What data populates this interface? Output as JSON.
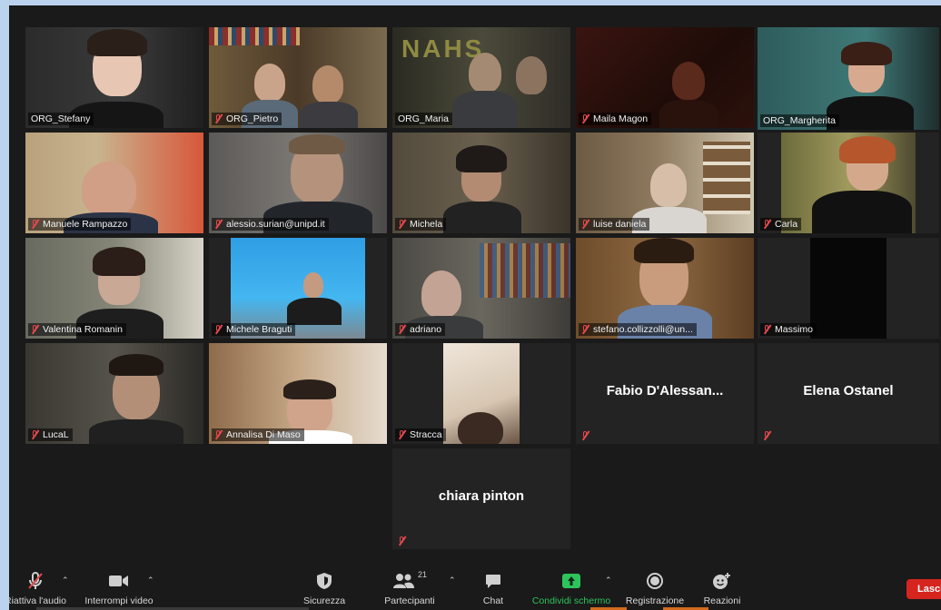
{
  "participants": [
    {
      "name": "ORG_Stefany",
      "muted": false
    },
    {
      "name": "ORG_Pietro",
      "muted": true
    },
    {
      "name": "ORG_Maria",
      "muted": false
    },
    {
      "name": "Maila Magon",
      "muted": true
    },
    {
      "name": "ORG_Margherita",
      "muted": false,
      "active": true
    },
    {
      "name": "Manuele Rampazzo",
      "muted": true
    },
    {
      "name": "alessio.surian@unipd.it",
      "muted": true
    },
    {
      "name": "Michela",
      "muted": true
    },
    {
      "name": "luise daniela",
      "muted": true
    },
    {
      "name": "Carla",
      "muted": true
    },
    {
      "name": "Valentina Romanin",
      "muted": true
    },
    {
      "name": "Michele Braguti",
      "muted": true
    },
    {
      "name": "adriano",
      "muted": true
    },
    {
      "name": "stefano.collizzolli@un...",
      "muted": true
    },
    {
      "name": "Massimo",
      "muted": true
    },
    {
      "name": "LucaL",
      "muted": true
    },
    {
      "name": "Annalisa Di Maso",
      "muted": true
    },
    {
      "name": "Stracca",
      "muted": true
    },
    {
      "name": "Fabio  D'Alessan...",
      "muted": true,
      "video_off": true
    },
    {
      "name": "Elena Ostanel",
      "muted": true,
      "video_off": true
    },
    {
      "name": "chiara pinton",
      "muted": true,
      "video_off": true
    }
  ],
  "toolbar": {
    "audio_label": "Riattiva l'audio",
    "video_label": "Interrompi video",
    "security_label": "Sicurezza",
    "participants_label": "Partecipanti",
    "participants_count": "21",
    "chat_label": "Chat",
    "share_label": "Condividi schermo",
    "record_label": "Registrazione",
    "reactions_label": "Reazioni",
    "leave_label": "Lascia"
  },
  "colors": {
    "active_border": "#eef0a0",
    "share_green": "#2ec45b",
    "leave_red": "#d6241f",
    "mute_red": "#e5484d"
  }
}
